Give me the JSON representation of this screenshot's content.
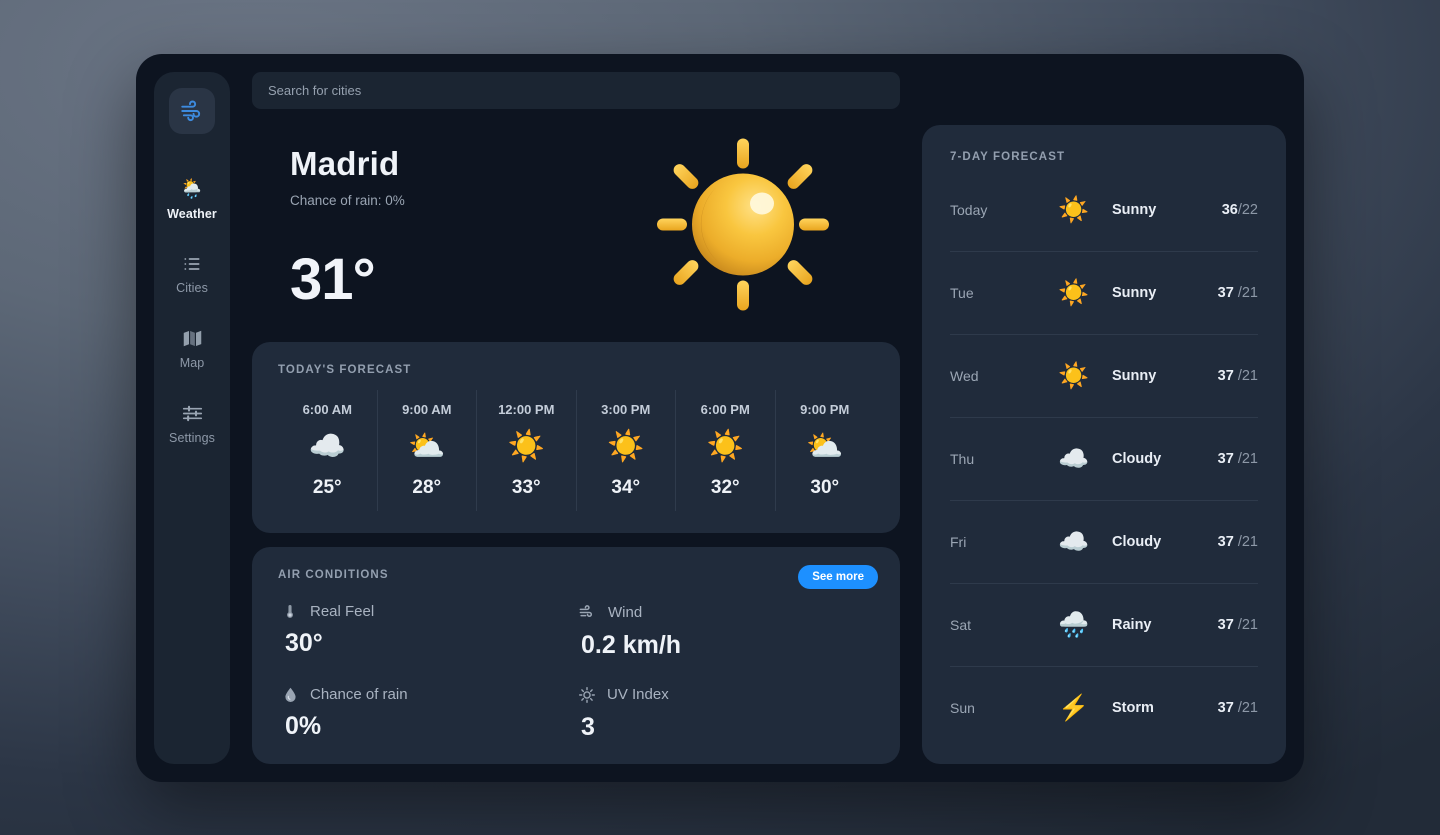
{
  "theme": {
    "accent": "#1d90ff",
    "card_bg": "#202b3b",
    "window_bg": "#0d1420",
    "sidebar_bg": "#1b2532"
  },
  "sidebar": {
    "logo_icon": "wind-icon",
    "items": [
      {
        "label": "Weather",
        "icon": "🌦️",
        "icon_name": "sun-behind-rain-cloud-icon",
        "active": true
      },
      {
        "label": "Cities",
        "icon": "list-icon",
        "icon_name": "list-icon",
        "active": false
      },
      {
        "label": "Map",
        "icon": "map-icon",
        "icon_name": "map-icon",
        "active": false
      },
      {
        "label": "Settings",
        "icon": "sliders-icon",
        "icon_name": "sliders-icon",
        "active": false
      }
    ]
  },
  "search": {
    "placeholder": "Search for cities",
    "value": ""
  },
  "current": {
    "city": "Madrid",
    "rain_chance_text": "Chance of rain: 0%",
    "temperature": "31°",
    "icon_name": "sun-icon"
  },
  "todays_forecast": {
    "title": "TODAY'S FORECAST",
    "hours": [
      {
        "time": "6:00 AM",
        "icon": "☁️",
        "icon_name": "cloud-icon",
        "temp": "25°"
      },
      {
        "time": "9:00 AM",
        "icon": "⛅",
        "icon_name": "sun-behind-cloud-icon",
        "temp": "28°"
      },
      {
        "time": "12:00 PM",
        "icon": "☀️",
        "icon_name": "sun-icon",
        "temp": "33°"
      },
      {
        "time": "3:00 PM",
        "icon": "☀️",
        "icon_name": "sun-icon",
        "temp": "34°"
      },
      {
        "time": "6:00 PM",
        "icon": "☀️",
        "icon_name": "sun-icon",
        "temp": "32°"
      },
      {
        "time": "9:00 PM",
        "icon": "⛅",
        "icon_name": "sun-behind-cloud-icon",
        "temp": "30°"
      }
    ]
  },
  "air_conditions": {
    "title": "AIR CONDITIONS",
    "see_more_label": "See more",
    "items": [
      {
        "label": "Real Feel",
        "value": "30°",
        "icon_name": "thermometer-icon"
      },
      {
        "label": "Wind",
        "value": "0.2 km/h",
        "icon_name": "wind-icon"
      },
      {
        "label": "Chance of rain",
        "value": "0%",
        "icon_name": "water-drop-icon"
      },
      {
        "label": "UV Index",
        "value": "3",
        "icon_name": "uv-sun-icon"
      }
    ]
  },
  "weekly_forecast": {
    "title": "7-DAY FORECAST",
    "days": [
      {
        "day": "Today",
        "icon": "☀️",
        "icon_name": "sun-icon",
        "condition": "Sunny",
        "high": "36",
        "low": "/22"
      },
      {
        "day": "Tue",
        "icon": "☀️",
        "icon_name": "sun-icon",
        "condition": "Sunny",
        "high": "37",
        "low": " /21"
      },
      {
        "day": "Wed",
        "icon": "☀️",
        "icon_name": "sun-icon",
        "condition": "Sunny",
        "high": "37",
        "low": " /21"
      },
      {
        "day": "Thu",
        "icon": "☁️",
        "icon_name": "cloud-icon",
        "condition": "Cloudy",
        "high": "37",
        "low": " /21"
      },
      {
        "day": "Fri",
        "icon": "☁️",
        "icon_name": "cloud-icon",
        "condition": "Cloudy",
        "high": "37",
        "low": " /21"
      },
      {
        "day": "Sat",
        "icon": "🌧️",
        "icon_name": "rain-cloud-icon",
        "condition": "Rainy",
        "high": "37",
        "low": " /21"
      },
      {
        "day": "Sun",
        "icon": "⚡",
        "icon_name": "lightning-icon",
        "condition": "Storm",
        "high": "37",
        "low": " /21"
      }
    ]
  }
}
